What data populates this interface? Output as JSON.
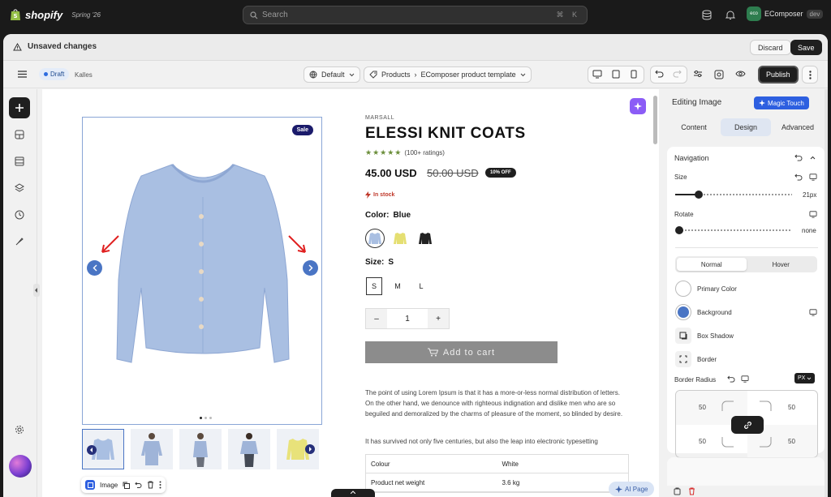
{
  "topbar": {
    "logo_text": "shopify",
    "edition": "Spring '26",
    "search_placeholder": "Search",
    "search_shortcut": "⌘ K",
    "store_avatar": "eco",
    "store_name": "EComposer",
    "store_badge": "dev"
  },
  "unsaved_bar": {
    "message": "Unsaved changes",
    "discard_label": "Discard",
    "save_label": "Save"
  },
  "toolbar": {
    "status": "Draft",
    "app_name": "Kalles",
    "theme_select": "Default",
    "breadcrumb_parent": "Products",
    "breadcrumb_separator": "›",
    "breadcrumb_current": "EComposer product template",
    "publish_label": "Publish"
  },
  "product": {
    "sale_badge": "Sale",
    "brand": "MARSALL",
    "title": "ELESSI KNIT COATS",
    "stars": "★★★★★",
    "ratings": "(100+ ratings)",
    "price": "45.00 USD",
    "old_price": "50.00 USD",
    "discount": "10% OFF",
    "stock": "In stock",
    "color_label": "Color:",
    "color_value": "Blue",
    "size_label": "Size:",
    "size_value": "S",
    "sizes": [
      "S",
      "M",
      "L"
    ],
    "qty_minus": "–",
    "qty_value": "1",
    "qty_plus": "+",
    "add_to_cart": "Add to cart",
    "description": "The point of using Lorem Ipsum is that it has a more-or-less normal distribution of letters. On the other hand, we denounce with righteous indignation and dislike men who are so beguiled and demoralized by the charms of pleasure of the moment, so blinded by desire.",
    "description_2": "It has survived not only five centuries, but also the leap into electronic typesetting",
    "specs": [
      {
        "key": "Colour",
        "value": "White"
      },
      {
        "key": "Product net weight",
        "value": "3.6 kg"
      }
    ]
  },
  "image_toolbar": {
    "label": "Image"
  },
  "ai_page": {
    "label": "AI Page"
  },
  "panel": {
    "title": "Editing Image",
    "magic_touch": "Magic Touch",
    "tabs": [
      "Content",
      "Design",
      "Advanced"
    ],
    "active_tab": "Design",
    "section": "Navigation",
    "size_label": "Size",
    "size_value": "21px",
    "size_fraction": 0.2,
    "rotate_label": "Rotate",
    "rotate_value": "none",
    "state_tabs": [
      "Normal",
      "Hover"
    ],
    "primary_color_label": "Primary Color",
    "background_label": "Background",
    "background_color": "#4a75c4",
    "box_shadow_label": "Box Shadow",
    "border_label": "Border",
    "border_radius_label": "Border Radius",
    "unit": "PX",
    "radius": {
      "top_left": "50",
      "top_right": "50",
      "bottom_left": "50",
      "bottom_right": "50"
    }
  }
}
